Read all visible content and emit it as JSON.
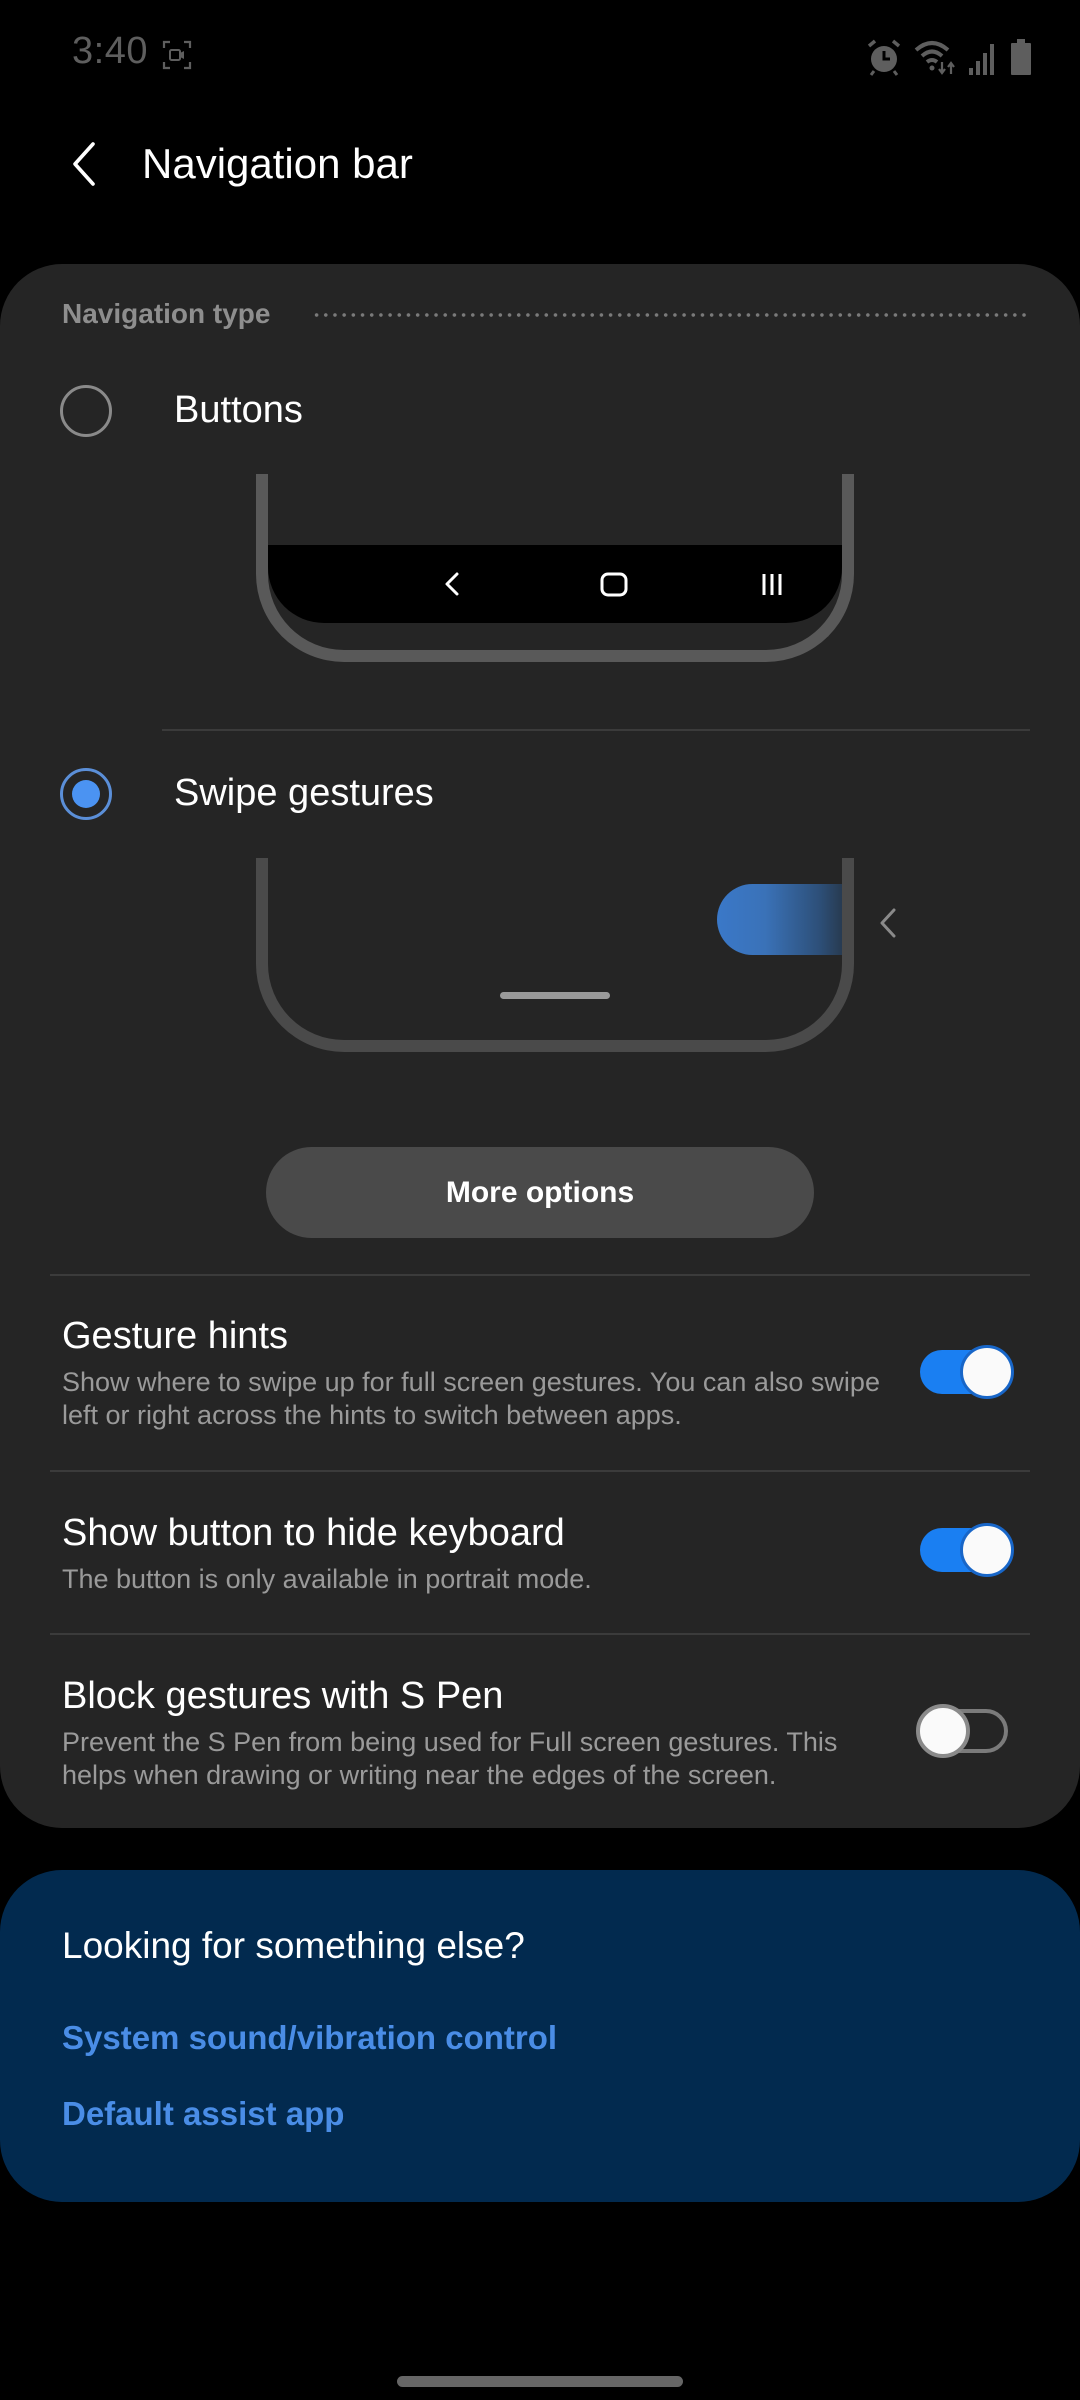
{
  "status_bar": {
    "time": "3:40",
    "icons": [
      "screen-record-icon",
      "alarm-icon",
      "wifi-icon",
      "signal-icon",
      "battery-icon"
    ]
  },
  "header": {
    "back_icon": "chevron-left-icon",
    "title": "Navigation bar"
  },
  "navigation_type": {
    "section_label": "Navigation type",
    "options": [
      {
        "label": "Buttons",
        "selected": false,
        "preview_icons": [
          "back-icon",
          "home-icon",
          "recents-icon"
        ]
      },
      {
        "label": "Swipe gestures",
        "selected": true,
        "preview_icons": [
          "gesture-pill",
          "chevron-left-icon",
          "home-handle"
        ]
      }
    ],
    "more_options_label": "More options"
  },
  "settings": [
    {
      "title": "Gesture hints",
      "description": "Show where to swipe up for full screen gestures. You can also swipe left or right across the hints to switch between apps.",
      "enabled": true
    },
    {
      "title": "Show button to hide keyboard",
      "description": "The button is only available in portrait mode.",
      "enabled": true
    },
    {
      "title": "Block gestures with S Pen",
      "description": "Prevent the S Pen from being used for Full screen gestures. This helps when drawing or writing near the edges of the screen.",
      "enabled": false
    }
  ],
  "related": {
    "title": "Looking for something else?",
    "links": [
      "System sound/vibration control",
      "Default assist app"
    ]
  },
  "colors": {
    "accent": "#1a7ff2",
    "radio_selected": "#4b93f2",
    "link": "#4a8de6",
    "card_bg": "#252525",
    "related_bg": "#022a4f"
  }
}
